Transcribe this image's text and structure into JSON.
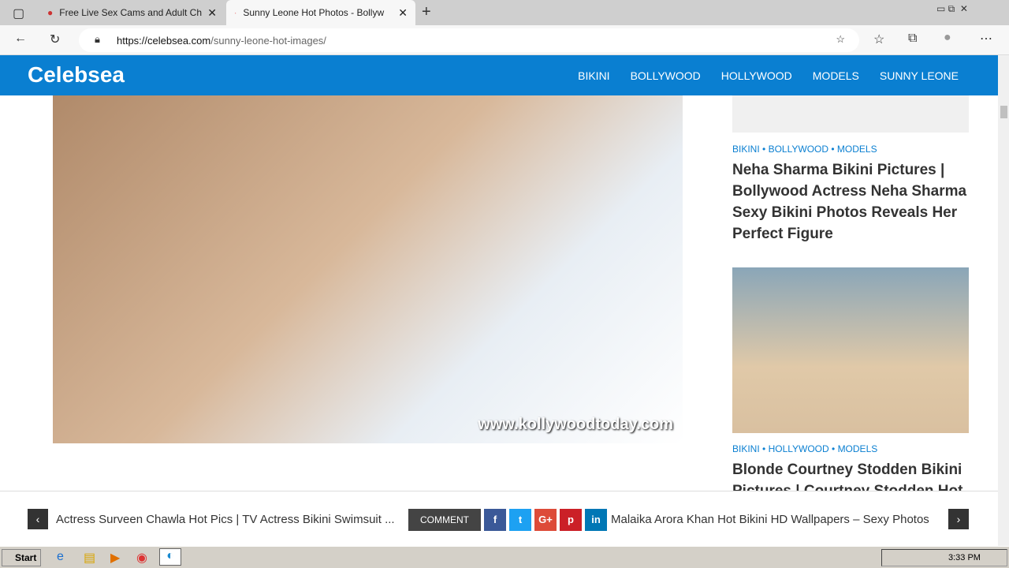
{
  "browser": {
    "tabs": [
      {
        "title": "Free Live Sex Cams and Adult Ch"
      },
      {
        "title": "Sunny Leone Hot Photos - Bollyw"
      }
    ],
    "url_domain": "https://celebsea.com",
    "url_path": "/sunny-leone-hot-images/"
  },
  "site": {
    "logo": "Celebsea",
    "menu": [
      "BIKINI",
      "BOLLYWOOD",
      "HOLLYWOOD",
      "MODELS",
      "SUNNY LEONE"
    ]
  },
  "main": {
    "image_watermark": "www.kollywoodtoday.com"
  },
  "sidebar": [
    {
      "cats": [
        "BIKINI",
        "BOLLYWOOD",
        "MODELS"
      ],
      "title": "Neha Sharma Bikini Pictures | Bollywood Actress Neha Sharma Sexy Bikini Photos Reveals Her Perfect Figure"
    },
    {
      "cats": [
        "BIKINI",
        "HOLLYWOOD",
        "MODELS"
      ],
      "title": "Blonde Courtney Stodden Bikini Pictures | Courtney Stodden Hot"
    }
  ],
  "bottom": {
    "prev": "Actress Surveen Chawla Hot Pics | TV Actress Bikini Swimsuit ...",
    "comment": "COMMENT",
    "next": "Malaika Arora Khan Hot Bikini HD Wallpapers – Sexy Photos",
    "social": [
      {
        "label": "f",
        "color": "#3b5998"
      },
      {
        "label": "t",
        "color": "#1da1f2"
      },
      {
        "label": "G+",
        "color": "#dd4b39"
      },
      {
        "label": "p",
        "color": "#cb2027"
      },
      {
        "label": "in",
        "color": "#0077b5"
      }
    ]
  },
  "taskbar": {
    "start": "Start",
    "time": "3:33 PM"
  }
}
